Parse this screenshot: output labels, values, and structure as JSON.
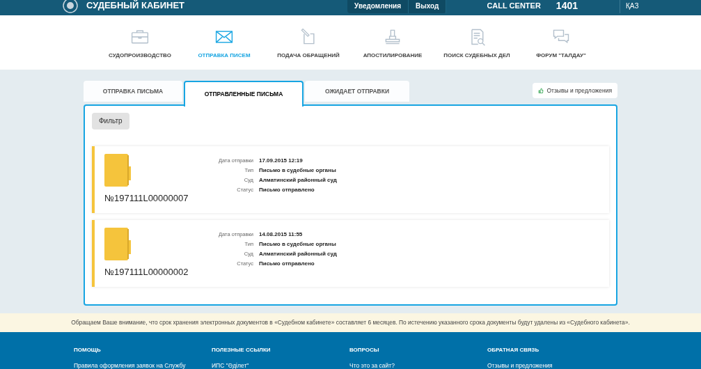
{
  "header": {
    "title": "СУДЕБНЫЙ КАБИНЕТ",
    "buttons": [
      {
        "label": "Уведомления"
      },
      {
        "label": "Выход"
      }
    ],
    "call_center": "CALL CENTER",
    "phone": "1401",
    "language": "ҚАЗ"
  },
  "nav": [
    {
      "label": "СУДОПРОИЗВОДСТВО",
      "kind": "briefcase",
      "selected": false
    },
    {
      "label": "ОТПРАВКА ПИСЕМ",
      "kind": "envelope",
      "selected": true
    },
    {
      "label": "ПОДАЧА ОБРАЩЕНИЙ",
      "kind": "pen",
      "selected": false
    },
    {
      "label": "АПОСТИЛИРОВАНИЕ",
      "kind": "stamp",
      "selected": false
    },
    {
      "label": "ПОИСК СУДЕБНЫХ ДЕЛ",
      "kind": "search",
      "selected": false
    },
    {
      "label": "ФОРУМ \"ТАЛДАУ\"",
      "kind": "chat",
      "selected": false
    }
  ],
  "tabs": [
    {
      "label": "ОТПРАВКА ПИСЬМА",
      "selected": false
    },
    {
      "label": "ОТПРАВЛЕННЫЕ ПИСЬМА",
      "selected": true
    },
    {
      "label": "ОЖИДАЕТ ОТПРАВКИ",
      "selected": false
    }
  ],
  "feedback_button": "Отзывы и предложения",
  "filter_button": "Фильтр",
  "letters": [
    {
      "number": "№197111L00000007",
      "fields": [
        {
          "label": "Дата отправки",
          "value": "17.09.2015 12:19"
        },
        {
          "label": "Тип",
          "value": "Письмо в судебные органы"
        },
        {
          "label": "Суд",
          "value": "Алматинский районный суд"
        },
        {
          "label": "Статус",
          "value": "Письмо отправлено"
        }
      ]
    },
    {
      "number": "№197111L00000002",
      "fields": [
        {
          "label": "Дата отправки",
          "value": "14.08.2015 11:55"
        },
        {
          "label": "Тип",
          "value": "Письмо в судебные органы"
        },
        {
          "label": "Суд",
          "value": "Алматинский районный суд"
        },
        {
          "label": "Статус",
          "value": "Письмо отправлено"
        }
      ]
    }
  ],
  "notice": "Обращаем Ваше внимание, что срок хранения электронных документов в «Судебном кабинете» составляет 6 месяцев. По истечению указанного срока документы будут удалены из «Судебного кабинета».",
  "footer": [
    {
      "heading": "ПОМОЩЬ",
      "link": "Правила оформления заявок на Службу"
    },
    {
      "heading": "ПОЛЕЗНЫЕ ССЫЛКИ",
      "link": "ИПС \"Әділет\""
    },
    {
      "heading": "ВОПРОСЫ",
      "link": "Что это за сайт?"
    },
    {
      "heading": "ОБРАТНАЯ СВЯЗЬ",
      "link": "Отзывы и предложения"
    }
  ]
}
